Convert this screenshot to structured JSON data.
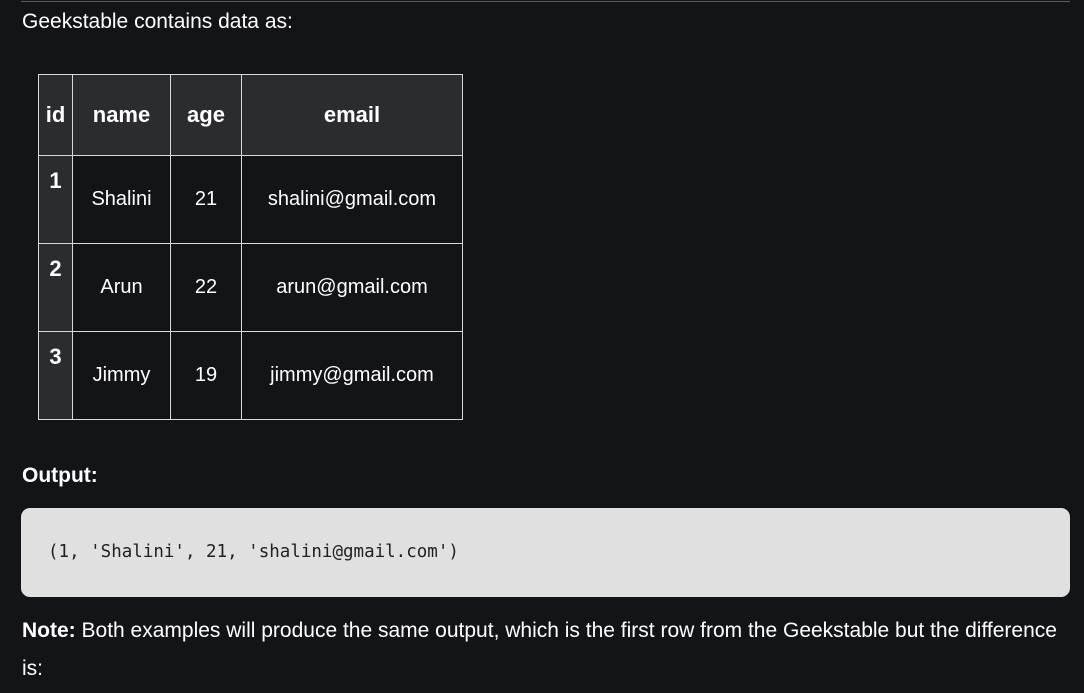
{
  "intro_text": "Geekstable contains data as:",
  "table": {
    "headers": [
      "id",
      "name",
      "age",
      "email"
    ],
    "rows": [
      {
        "id": "1",
        "name": "Shalini",
        "age": "21",
        "email": "shalini@gmail.com"
      },
      {
        "id": "2",
        "name": "Arun",
        "age": "22",
        "email": "arun@gmail.com"
      },
      {
        "id": "3",
        "name": "Jimmy",
        "age": "19",
        "email": "jimmy@gmail.com"
      }
    ]
  },
  "output_label": "Output:",
  "code_output": "(1, 'Shalini', 21, 'shalini@gmail.com')",
  "note": {
    "label": "Note:",
    "text": " Both examples will produce the same output, which is the first row from the Geekstable but the difference is:"
  },
  "colors": {
    "background": "#131417",
    "header_cell": "#2b2c30",
    "code_background": "#e0e0e0",
    "border": "#d9d9d9"
  }
}
